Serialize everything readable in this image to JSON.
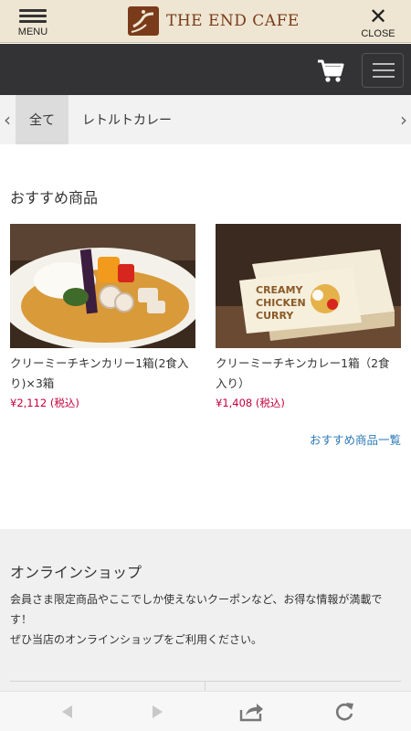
{
  "brand": {
    "menu_label": "MENU",
    "logo_text": "THE END CAFE",
    "close_label": "CLOSE"
  },
  "tabs": {
    "items": [
      {
        "label": "全て",
        "active": true
      },
      {
        "label": "レトルトカレー",
        "active": false
      }
    ]
  },
  "recommended": {
    "title": "おすすめ商品",
    "more_link": "おすすめ商品一覧",
    "products": [
      {
        "name": "クリーミーチキンカリー1箱(2食入り)×3箱",
        "price": "¥2,112",
        "tax": "(税込)"
      },
      {
        "name": "クリーミーチキンカレー1箱（2食入り）",
        "price": "¥1,408",
        "tax": "(税込)"
      }
    ]
  },
  "shop": {
    "title": "オンラインショップ",
    "desc_line1": "会員さま限定商品やここでしか使えないクーポンなど、お得な情報が満載です！",
    "desc_line2": "ぜひ当店のオンラインショップをご利用ください。"
  },
  "colors": {
    "brand_brown": "#7a3b1a",
    "header_dark": "#333335",
    "price_red": "#c4003c",
    "link_blue": "#2e7ab8"
  }
}
